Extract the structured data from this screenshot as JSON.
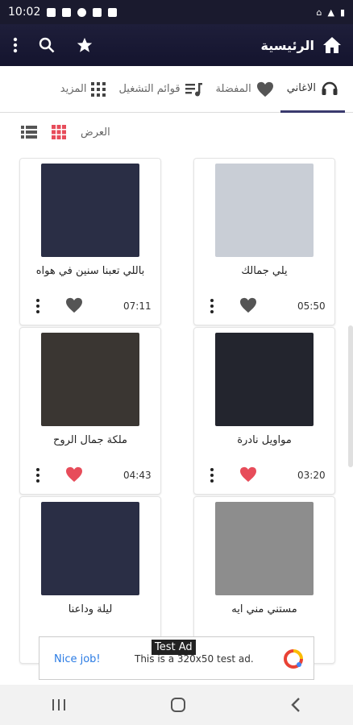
{
  "status": {
    "time": "10:02",
    "battery_label": "5G"
  },
  "appbar": {
    "title": "الرئيسية"
  },
  "tabs": [
    {
      "label": "الاغاني"
    },
    {
      "label": "المفضلة"
    },
    {
      "label": "قوائم التشغيل"
    },
    {
      "label": "المزيد"
    }
  ],
  "view": {
    "label": "العرض"
  },
  "songs": [
    {
      "title": "يلي جمالك",
      "duration": "05:50",
      "favorite": false
    },
    {
      "title": "باللي تعبنا سنين في هواه",
      "duration": "07:11",
      "favorite": false
    },
    {
      "title": "مواويل نادرة",
      "duration": "03:20",
      "favorite": true
    },
    {
      "title": "ملكة جمال الروح",
      "duration": "04:43",
      "favorite": true
    },
    {
      "title": "مستني مني ايه",
      "duration": "",
      "favorite": false
    },
    {
      "title": "ليلة وداعنا",
      "duration": "",
      "favorite": false
    }
  ],
  "ad": {
    "label": "Nice job!",
    "text": "This is a 320x50 test ad.",
    "badge": "Test Ad"
  },
  "colors": {
    "accent": "#e74c5a",
    "appbar": "#1e1e3a",
    "heart_off": "#555555"
  }
}
